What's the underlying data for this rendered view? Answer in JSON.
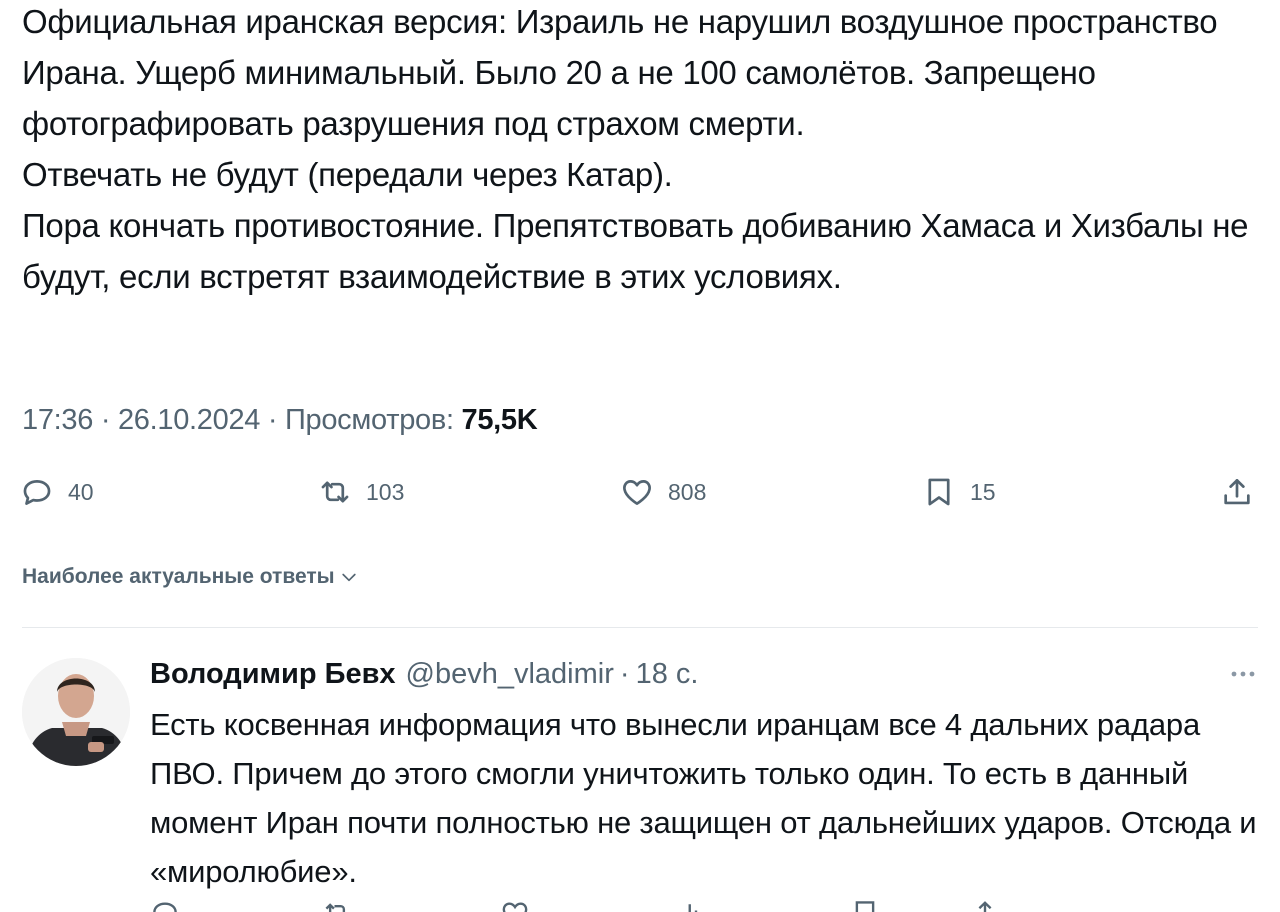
{
  "tweet": {
    "paragraphs": [
      "Официальная иранская версия: Израиль не нарушил воздушное пространство Ирана. Ущерб минимальный. Было 20 а не 100 самолётов.  Запрещено фотографировать разрушения под страхом смерти.",
      "Отвечать не будут (передали через Катар).",
      "Пора кончать противостояние. Препятствовать добиванию Хамаса и Хизбалы не будут, если встретят взаимодействие в этих условиях."
    ],
    "time": "17:36",
    "date": "26.10.2024",
    "views_label": "Просмотров:",
    "views_count": "75,5K",
    "separator": " · "
  },
  "actions": {
    "replies": "40",
    "reposts": "103",
    "likes": "808",
    "bookmarks": "15"
  },
  "sort": {
    "label": "Наиболее актуальные ответы"
  },
  "reply": {
    "name": "Володимир Бевх",
    "handle": "@bevh_vladimir",
    "dot": "·",
    "time": "18 с.",
    "text": "Есть косвенная информация что вынесли иранцам все 4 дальних радара ПВО. Причем до этого смогли уничтожить только один. То есть в данный момент Иран почти полностью не защищен от дальнейших ударов. Отсюда и «миролюбие»."
  },
  "icons": {
    "reply": "reply-icon",
    "repost": "repost-icon",
    "like": "heart-icon",
    "bookmark": "bookmark-icon",
    "share": "share-icon",
    "more": "more-icon",
    "chevron": "chevron-down-icon"
  },
  "colors": {
    "text": "#0f1419",
    "secondary": "#536471",
    "divider": "#e6e9ec"
  }
}
